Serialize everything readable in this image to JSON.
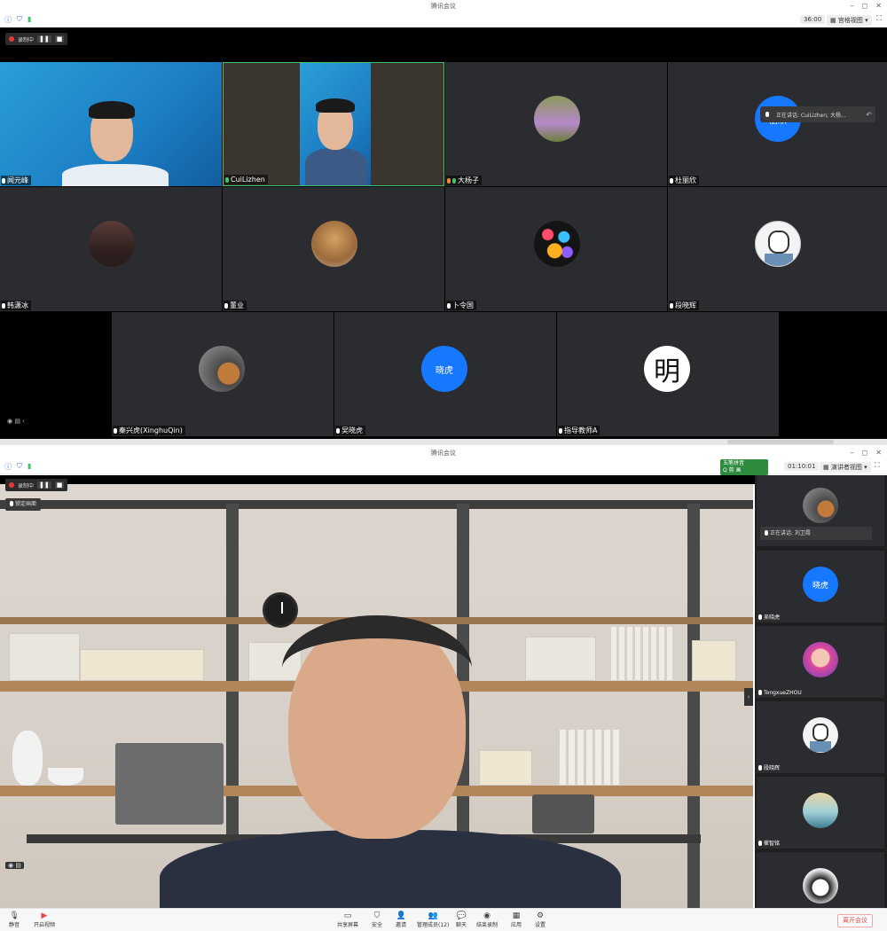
{
  "window1": {
    "title": "腾讯会议",
    "timer": "36:00",
    "view_label": "宫格视图",
    "recording_label": "录制中",
    "speaking_banner": "正在讲话: CuiLizhen; 大杨...",
    "participants": [
      {
        "name": "闻元峰"
      },
      {
        "name": "CuiLizhen"
      },
      {
        "name": "大杨子"
      },
      {
        "name": "杜丽欣",
        "avatar_text": "丽欣"
      },
      {
        "name": "韩潇冰"
      },
      {
        "name": "董业"
      },
      {
        "name": "卜令国"
      },
      {
        "name": "段晓辉"
      },
      {
        "name": "秦兴虎(XinghuQin)"
      },
      {
        "name": "吴晓虎",
        "avatar_text": "晓虎"
      },
      {
        "name": "指导教师A",
        "avatar_text": "明"
      }
    ]
  },
  "window2": {
    "title": "腾讯会议",
    "timer": "01:10:01",
    "view_label": "演讲者视图",
    "recording_label": "录制中",
    "lock_label": "锁定画面",
    "helper": {
      "line1": "五笔拼音",
      "line2": "Q 剪 画"
    },
    "speaking_banner": "正在讲话: 刘卫霞",
    "side_tiles": [
      {
        "name": "吴晓虎",
        "avatar_text": "晓虎"
      },
      {
        "name": "TongxueZHOU"
      },
      {
        "name": "段晓辉"
      },
      {
        "name": "崔智铭"
      }
    ],
    "toolbar": {
      "mute": "静音",
      "video": "开启视频",
      "share": "共享屏幕",
      "security": "安全",
      "invite": "邀请",
      "members": "管理成员(12)",
      "chat": "聊天",
      "record": "结束录制",
      "apps": "应用",
      "settings": "设置",
      "leave": "离开会议"
    }
  },
  "colors": {
    "accent_blue": "#1677ff",
    "record_red": "#e53935",
    "leave_red": "#e54545",
    "tile_bg": "#2b2c2f"
  }
}
